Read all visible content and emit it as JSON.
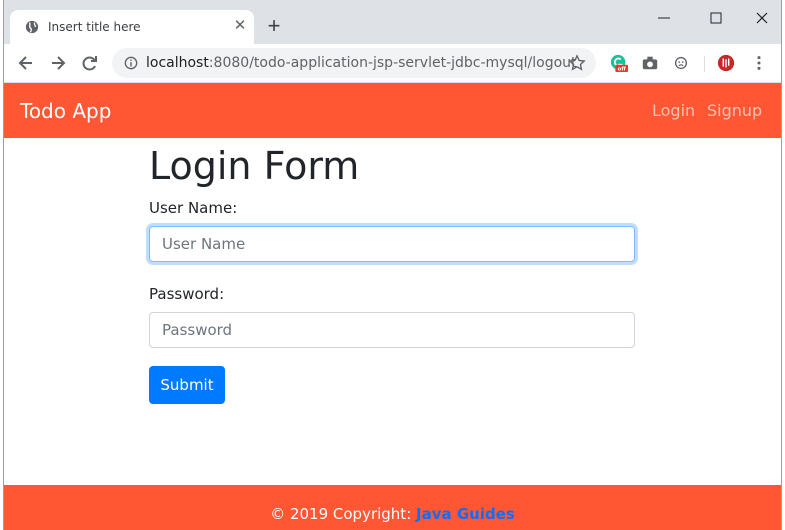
{
  "browser": {
    "tab_title": "Insert title here",
    "new_tab": "+",
    "url_host": "localhost",
    "url_rest": ":8080/todo-application-jsp-servlet-jdbc-mysql/logout",
    "grammarly_badge": "off"
  },
  "navbar": {
    "brand": "Todo App",
    "login": "Login",
    "signup": "Signup"
  },
  "form": {
    "title": "Login Form",
    "username_label": "User Name:",
    "username_placeholder": "User Name",
    "password_label": "Password:",
    "password_placeholder": "Password",
    "submit_label": "Submit"
  },
  "footer": {
    "prefix": "© 2019 Copyright: ",
    "link": "Java Guides"
  },
  "colors": {
    "navbar": "#ff5733",
    "button": "#007bff",
    "footer_link": "#0d6efd"
  }
}
